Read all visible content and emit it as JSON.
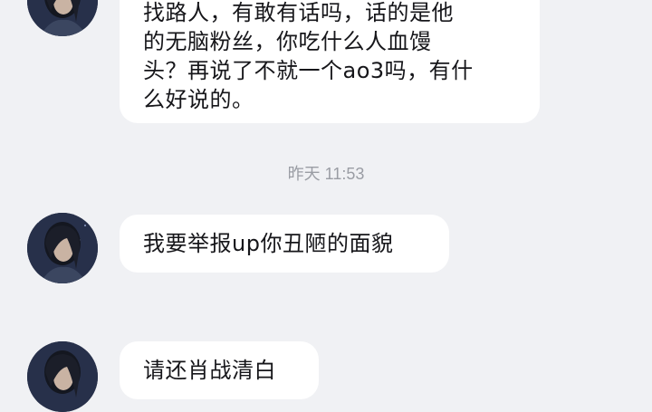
{
  "messages": [
    {
      "lines": [
        "找路人，有敢有话吗，话的是他",
        "的无脑粉丝，你吃什么人血馒",
        "头？再说了不就一个ao3吗，有什",
        "么好说的。"
      ]
    },
    {
      "lines": [
        "我要举报up你丑陋的面貌"
      ]
    },
    {
      "lines": [
        "请还肖战清白"
      ]
    }
  ],
  "timestamp": "昨天 11:53",
  "colors": {
    "background": "#f0f1f4",
    "bubble": "#ffffff",
    "text": "#16161a",
    "timestamp": "#9a9da4"
  }
}
